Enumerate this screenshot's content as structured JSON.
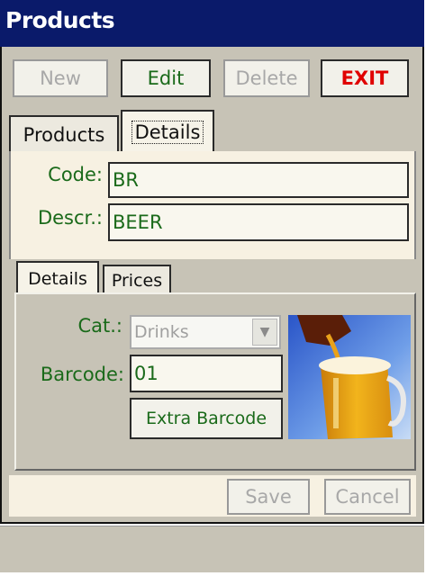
{
  "window": {
    "title": "Products"
  },
  "toolbar": {
    "new_label": "New",
    "edit_label": "Edit",
    "delete_label": "Delete",
    "exit_label": "EXIT"
  },
  "main_tabs": [
    {
      "label": "Products"
    },
    {
      "label": "Details"
    }
  ],
  "form": {
    "code_label": "Code:",
    "code_value": "BR",
    "descr_label": "Descr.:",
    "descr_value": "BEER"
  },
  "sub_tabs": [
    {
      "label": "Details"
    },
    {
      "label": "Prices"
    }
  ],
  "details": {
    "cat_label": "Cat.:",
    "cat_value": "Drinks",
    "barcode_label": "Barcode:",
    "barcode_value": "01",
    "extra_barcode_label": "Extra Barcode"
  },
  "actions": {
    "save_label": "Save",
    "cancel_label": "Cancel"
  },
  "colors": {
    "titlebar": "#0a1a6a",
    "label_green": "#1a6a1a",
    "exit_red": "#e00000",
    "panel": "#f7f1e2",
    "frame": "#c7c3b6"
  },
  "icons": {
    "dropdown": "chevron-down-icon",
    "product_image": "beer-image"
  }
}
